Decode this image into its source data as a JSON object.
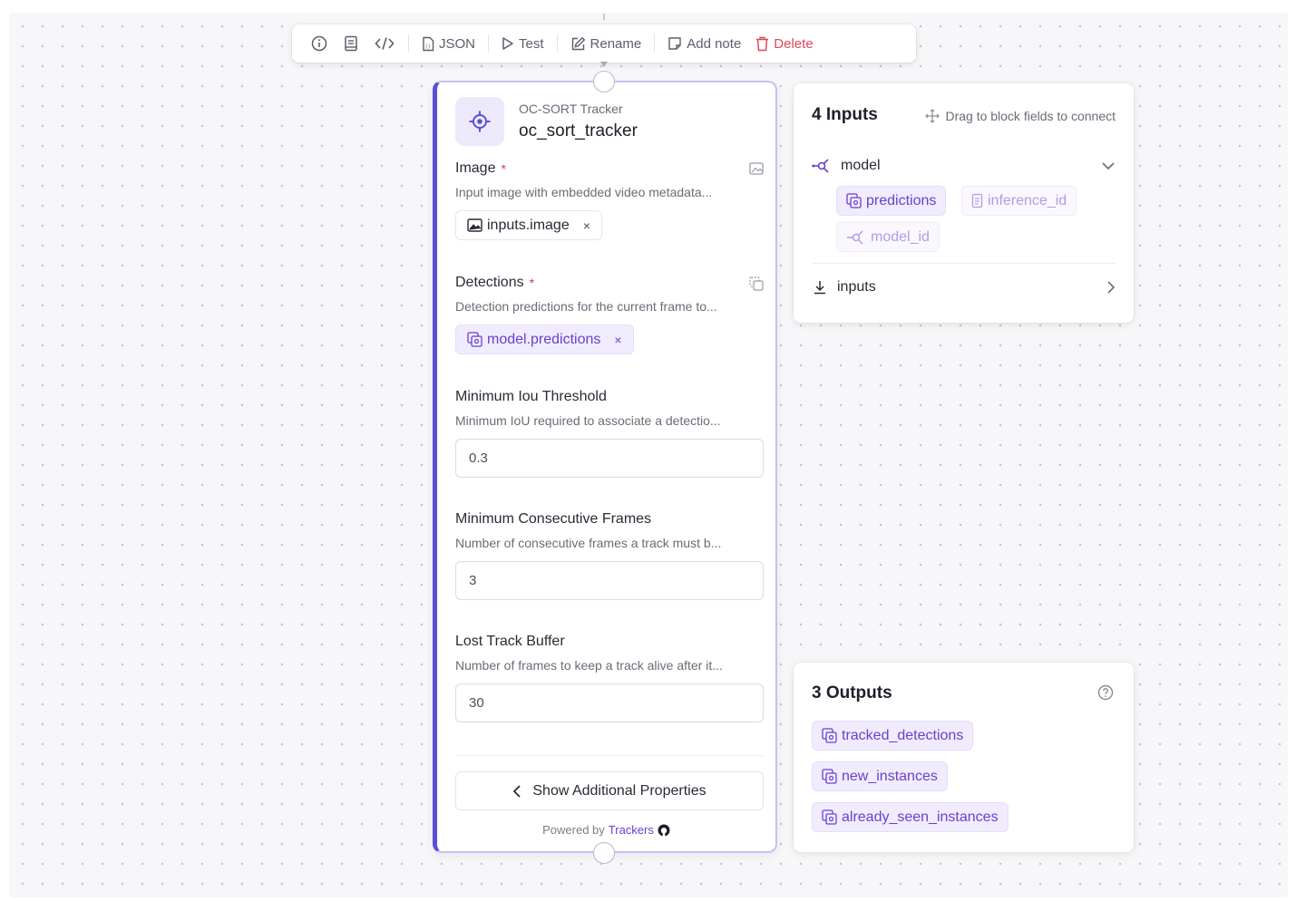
{
  "toolbar": {
    "json_label": "JSON",
    "test_label": "Test",
    "rename_label": "Rename",
    "add_note_label": "Add note",
    "delete_label": "Delete",
    "danger_color": "#e0465b"
  },
  "node": {
    "type_label": "OC-SORT Tracker",
    "name": "oc_sort_tracker",
    "accent_color": "#5b4fd6",
    "fields": {
      "image": {
        "label": "Image",
        "required_mark": "*",
        "description": "Input image with embedded video metadata...",
        "value": "inputs.image",
        "remove": "×"
      },
      "detections": {
        "label": "Detections",
        "required_mark": "*",
        "description": "Detection predictions for the current frame to...",
        "value": "model.predictions",
        "remove": "×"
      },
      "min_iou": {
        "label": "Minimum Iou Threshold",
        "description": "Minimum IoU required to associate a detectio...",
        "value": "0.3"
      },
      "min_frames": {
        "label": "Minimum Consecutive Frames",
        "description": "Number of consecutive frames a track must b...",
        "value": "3"
      },
      "lost_buffer": {
        "label": "Lost Track Buffer",
        "description": "Number of frames to keep a track alive after it...",
        "value": "30"
      }
    },
    "show_more_label": "Show Additional Properties",
    "powered_prefix": "Powered by",
    "powered_link": "Trackers"
  },
  "inputs_panel": {
    "title": "4 Inputs",
    "hint": "Drag to block fields to connect",
    "sections": [
      {
        "name": "model",
        "expanded": true,
        "fields": [
          "predictions",
          "inference_id",
          "model_id"
        ]
      },
      {
        "name": "inputs",
        "expanded": false
      }
    ]
  },
  "outputs_panel": {
    "title": "3 Outputs",
    "items": [
      "tracked_detections",
      "new_instances",
      "already_seen_instances"
    ]
  }
}
